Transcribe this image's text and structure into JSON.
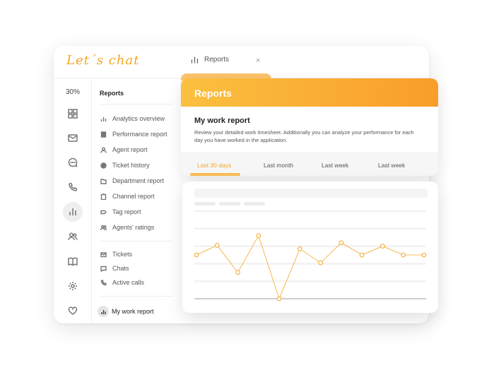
{
  "topbar": {
    "logo": "Let´s chat",
    "tab_label": "Reports",
    "tab_close": "×"
  },
  "rail": {
    "zoom": "30%"
  },
  "nav": {
    "title": "Reports",
    "reports": [
      {
        "label": "Analytics overview",
        "icon": "bar-chart-icon"
      },
      {
        "label": "Performance report",
        "icon": "document-icon"
      },
      {
        "label": "Agent report",
        "icon": "user-icon"
      },
      {
        "label": "Ticket history",
        "icon": "ticket-icon"
      },
      {
        "label": "Department report",
        "icon": "folder-icon"
      },
      {
        "label": "Channel report",
        "icon": "clipboard-icon"
      },
      {
        "label": "Tag report",
        "icon": "tag-icon"
      },
      {
        "label": "Agents' ratings",
        "icon": "users-icon"
      }
    ],
    "channels": [
      {
        "label": "Tickets",
        "icon": "envelope-icon"
      },
      {
        "label": "Chats",
        "icon": "chat-icon"
      },
      {
        "label": "Active calls",
        "icon": "phone-icon"
      }
    ],
    "my_report": "My work report"
  },
  "reports_card": {
    "header": "Reports",
    "title": "My work report",
    "description": "Review your detailed work timesheet. Additionally you can analyze your performance for each day you have worked in the application.",
    "tabs": [
      "Last 30 days",
      "Last month",
      "Last week",
      "Last week"
    ],
    "active_tab": 0
  },
  "colors": {
    "accent": "#f5a623",
    "header_start": "#fbc040",
    "header_end": "#f99d2a"
  },
  "chart_data": {
    "type": "line",
    "x": [
      1,
      2,
      3,
      4,
      5,
      6,
      7,
      8,
      9,
      10,
      11,
      12
    ],
    "series": [
      {
        "values": [
          50,
          61,
          30,
          72,
          0,
          57,
          41,
          64,
          50,
          60,
          50,
          50
        ]
      }
    ],
    "ylim": [
      0,
      100
    ],
    "grid": true,
    "xlabel": "",
    "ylabel": ""
  }
}
